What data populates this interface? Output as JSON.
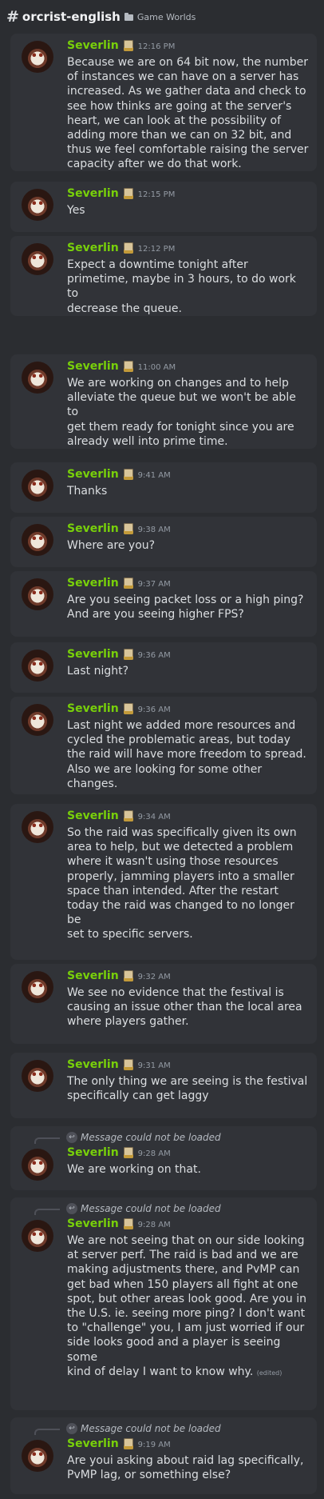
{
  "header": {
    "hash": "#",
    "channel": "orcrist-english",
    "category": "Game Worlds"
  },
  "messages": [
    {
      "author": "Severlin",
      "time": "12:16 PM",
      "text": "Because we are on 64 bit now, the number\nof instances we can have on a server has\nincreased. As we gather data and check to\nsee how thinks are going at the server's\nheart, we can look at the possibility of\nadding more than we can on 32 bit, and\nthus we feel comfortable raising the server\ncapacity after we do that work."
    },
    {
      "author": "Severlin",
      "time": "12:15 PM",
      "text": "Yes"
    },
    {
      "author": "Severlin",
      "time": "12:12 PM",
      "text": "Expect a downtime tonight after\nprimetime, maybe in 3 hours, to do work to\ndecrease the queue."
    },
    {
      "author": "Severlin",
      "time": "11:00 AM",
      "text": "We are working on changes and to help\nalleviate the queue but we won't be able to\nget them ready for tonight since you are\nalready well into prime time."
    },
    {
      "author": "Severlin",
      "time": "9:41 AM",
      "text": "Thanks"
    },
    {
      "author": "Severlin",
      "time": "9:38 AM",
      "text": "Where are you?"
    },
    {
      "author": "Severlin",
      "time": "9:37 AM",
      "text": "Are you seeing packet loss or a high ping?\nAnd are you seeing higher FPS?"
    },
    {
      "author": "Severlin",
      "time": "9:36 AM",
      "text": "Last night?"
    },
    {
      "author": "Severlin",
      "time": "9:36 AM",
      "text": "Last night we added more resources and\ncycled the problematic areas, but today\nthe raid will have more freedom to spread.\nAlso we are looking for some other changes."
    },
    {
      "author": "Severlin",
      "time": "9:34 AM",
      "text": "So the raid was specifically given its own\narea to help, but we detected a problem\nwhere it wasn't using those resources\nproperly, jamming players into a smaller\nspace than intended. After the restart\ntoday the raid was changed to no longer be\nset to specific servers."
    },
    {
      "author": "Severlin",
      "time": "9:32 AM",
      "text": "We see no evidence that the festival is\ncausing an issue other than the local area\nwhere players gather."
    },
    {
      "author": "Severlin",
      "time": "9:31 AM",
      "text": "The only thing we are seeing is the festival\nspecifically can get laggy"
    },
    {
      "reply": "Message could not be loaded",
      "author": "Severlin",
      "time": "9:28 AM",
      "text": "We are working on that."
    },
    {
      "reply": "Message could not be loaded",
      "author": "Severlin",
      "time": "9:28 AM",
      "text": "We are not seeing that on our side looking\nat server perf. The raid is bad and we are\nmaking adjustments there, and PvMP can\nget bad when 150 players all fight at one\nspot, but other areas look good. Are you in\nthe U.S. ie. seeing more ping? I don't want\nto \"challenge\" you, I am just worried if our\nside looks good and a player is seeing some\nkind of delay I want to know why.",
      "edited": "(edited)"
    },
    {
      "reply": "Message could not be loaded",
      "author": "Severlin",
      "time": "9:19 AM",
      "text": "Are youi asking about raid lag specifically,\nPvMP lag, or something else?"
    }
  ]
}
